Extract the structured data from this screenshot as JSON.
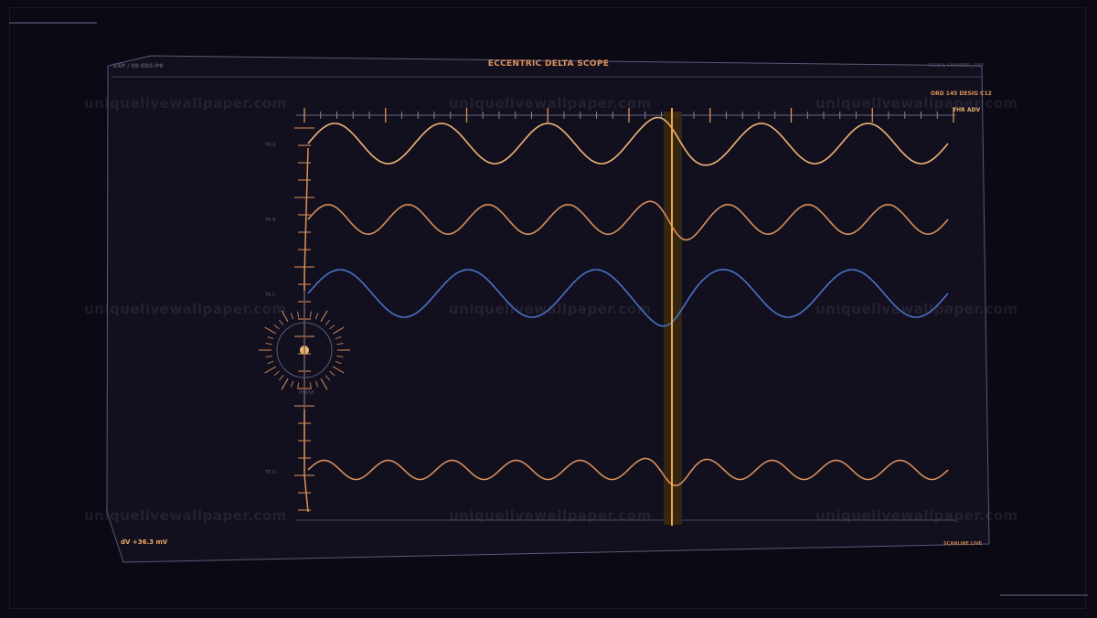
{
  "title": "ECCENTRIC DELTA SCOPE",
  "header_left": "EXP / 09  EDS-P8",
  "header_right": "SIGNAL CHAMBER  |  REV",
  "order_label": "ORD 145  DESIG C12",
  "advance_label": "THR ADV",
  "readout": "dV +36.3 mV",
  "status": "SCANLINE LIVE",
  "trace_labels": [
    "TR A",
    "TR B",
    "TR C",
    "TR D"
  ],
  "dial_label": "PHASE",
  "watermark": "uniquelivewallpaper.com",
  "colors": {
    "background": "#0b0a14",
    "panel": "#12101f",
    "panel_border": "#5a5878",
    "accent_orange": "#e0925a",
    "trace_light": "#f0b474",
    "trace_blue": "#4a72c4",
    "cursor": "#f5a834"
  },
  "scope": {
    "cursor_phase": 0.57,
    "traces": [
      {
        "color": "#f0b474",
        "cycles": 6,
        "amplitude": 1.0
      },
      {
        "color": "#d98e5c",
        "cycles": 8,
        "amplitude": 0.85
      },
      {
        "color": "#4a72c4",
        "cycles": 5,
        "amplitude": 1.0
      },
      {
        "color": "#d98e5c",
        "cycles": 10,
        "amplitude": 0.7
      }
    ]
  }
}
